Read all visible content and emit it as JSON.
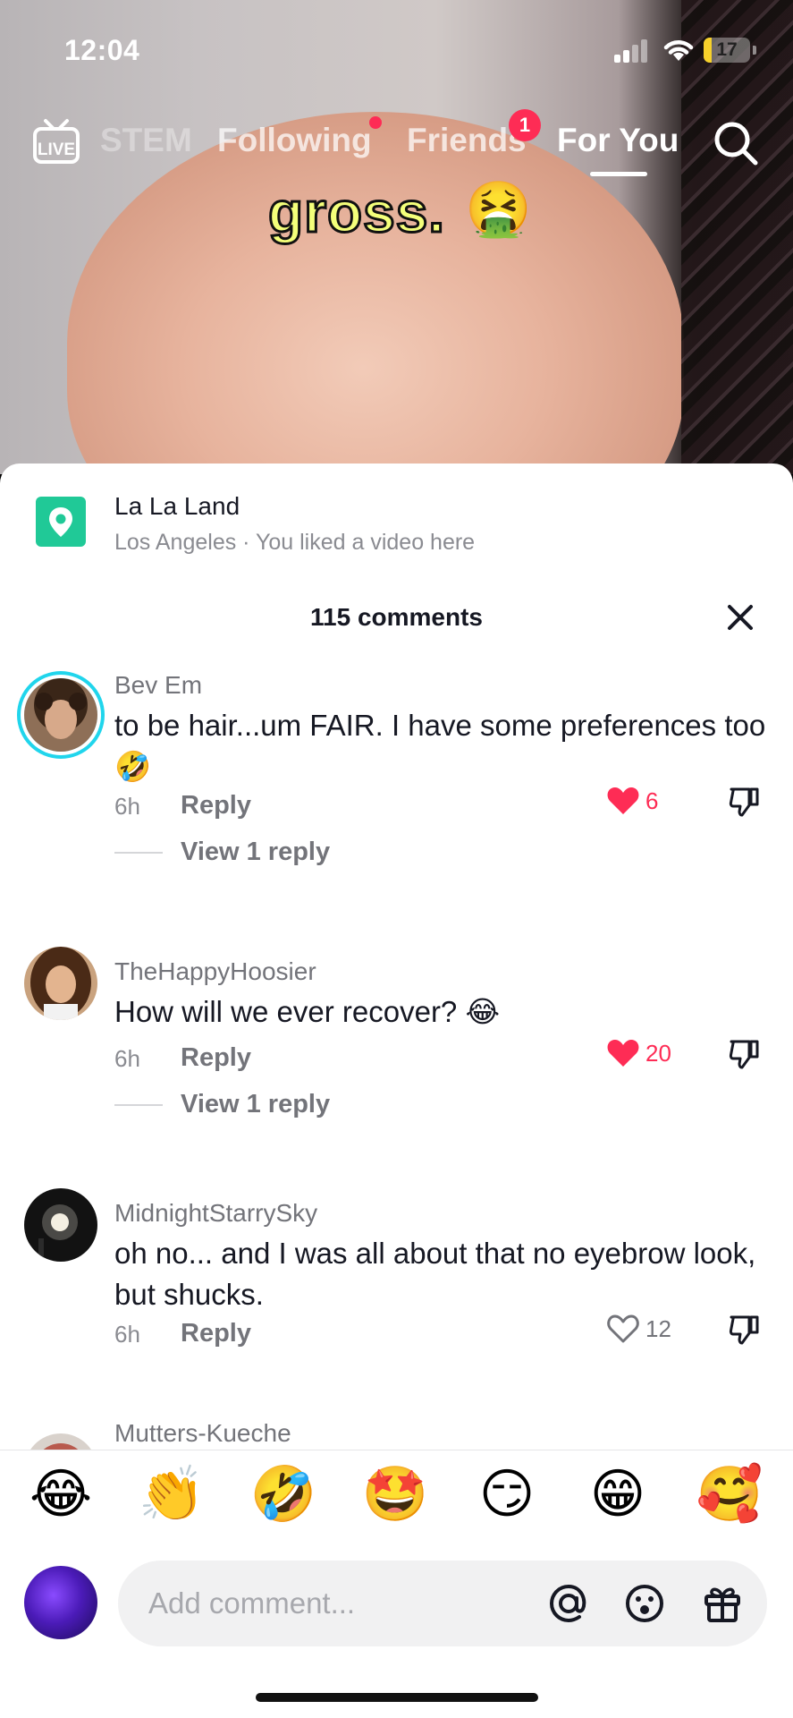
{
  "status_bar": {
    "time": "12:04",
    "battery": "17",
    "battery_level_percent": 17,
    "colors": {
      "battery_fill": "#f7d12b"
    }
  },
  "top_nav": {
    "live_label": "LIVE",
    "tabs": [
      {
        "label": "STEM",
        "state": "partially-hidden"
      },
      {
        "label": "Following",
        "has_dot": true
      },
      {
        "label": "Friends",
        "badge": "1"
      },
      {
        "label": "For You",
        "active": true
      }
    ],
    "search_icon": "search-icon"
  },
  "video": {
    "caption": "gross.",
    "caption_emoji": "🤮"
  },
  "location": {
    "title": "La La Land",
    "subtitle": "Los Angeles · You liked a video here",
    "icon": "location-pin-icon"
  },
  "comments_header": {
    "count_label": "115 comments",
    "close_icon": "close-icon"
  },
  "comments": [
    {
      "user": "Bev Em",
      "text": "to be hair...um FAIR. I have some preferences too 🤣",
      "time": "6h",
      "reply_label": "Reply",
      "likes": "6",
      "liked": true,
      "view_replies": "View 1 reply"
    },
    {
      "user": "TheHappyHoosier",
      "text": "How will we ever recover? 😂",
      "time": "6h",
      "reply_label": "Reply",
      "likes": "20",
      "liked": true,
      "view_replies": "View 1 reply"
    },
    {
      "user": "MidnightStarrySky",
      "text": "oh no... and I was all about that no eyebrow look, but shucks.",
      "time": "6h",
      "reply_label": "Reply",
      "likes": "12",
      "liked": false
    },
    {
      "user": "Mutters-Kueche"
    }
  ],
  "quick_emojis": [
    "😂",
    "👏",
    "🤣",
    "🤩",
    "😏",
    "😁",
    "🥰"
  ],
  "composer": {
    "placeholder": "Add comment...",
    "icons": [
      "at-icon",
      "emoji-icon",
      "gift-icon"
    ]
  },
  "colors": {
    "accent": "#fe2c55",
    "location_green": "#20c997",
    "story_ring": "#20d5ec",
    "text_primary": "#161823",
    "text_secondary": "#73747a"
  }
}
